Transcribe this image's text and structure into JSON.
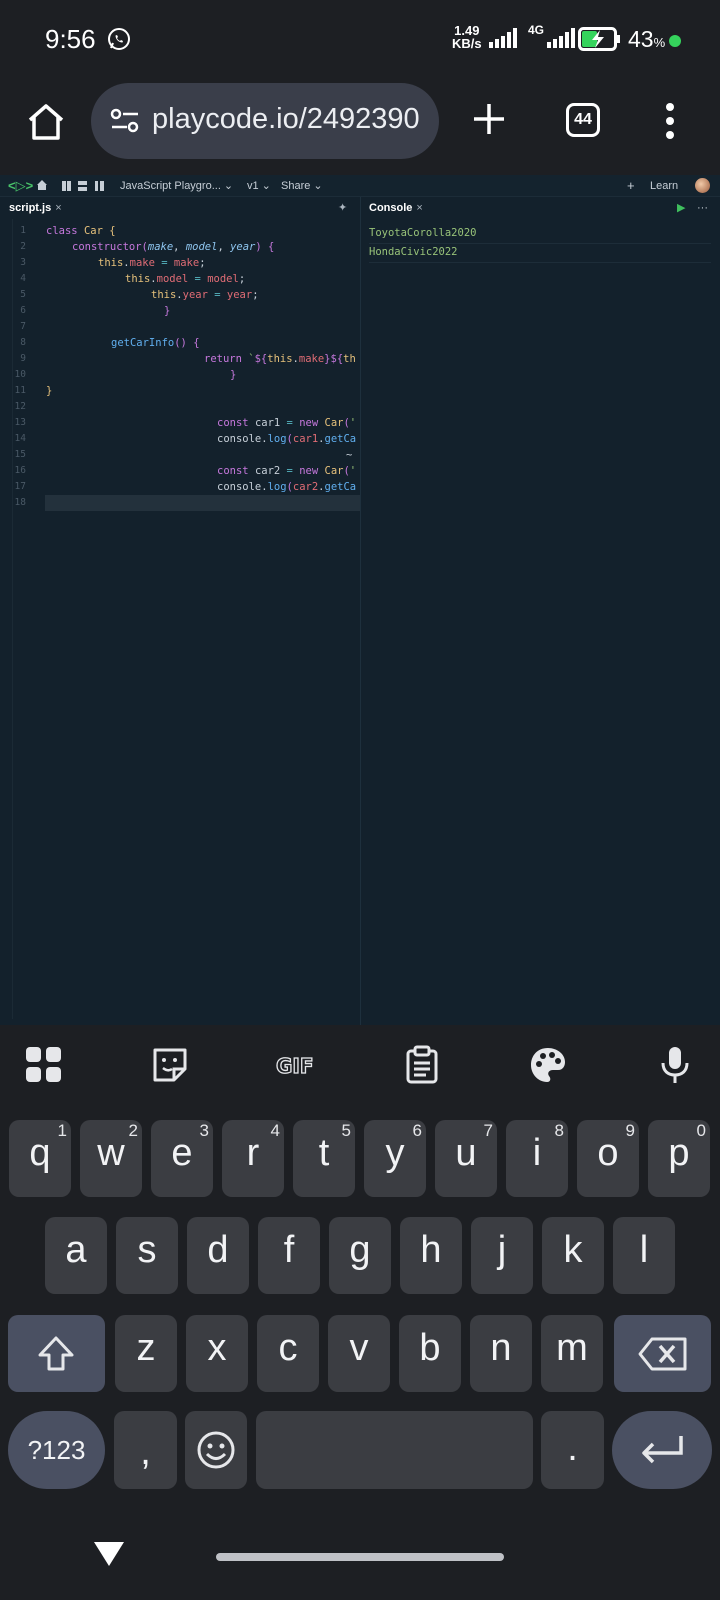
{
  "status_bar": {
    "time": "9:56",
    "net_speed_value": "1.49",
    "net_speed_unit": "KB/s",
    "network": "4G",
    "battery": "43",
    "battery_unit": "%"
  },
  "browser": {
    "url": "playcode.io/2492390",
    "tab_count": "44"
  },
  "editor": {
    "toolbar": {
      "logo": "<▷>",
      "project": "JavaScript Playgro... ⌄",
      "version": "v1 ⌄",
      "share": "Share ⌄",
      "new": "+",
      "learn": "Learn"
    },
    "file_tab": {
      "label": "script.js",
      "close": "×"
    },
    "console_tab": {
      "label": "Console",
      "close": "×"
    },
    "run": "▶",
    "more": "···",
    "line_numbers": [
      "1",
      "2",
      "3",
      "4",
      "5",
      "6",
      "7",
      "8",
      "9",
      "10",
      "11",
      "12",
      "13",
      "14",
      "15",
      "16",
      "17",
      "18"
    ],
    "console_output": [
      "ToyotaCorolla2020",
      "HondaCivic2022"
    ]
  },
  "keyboard": {
    "row1": [
      {
        "k": "q",
        "h": "1"
      },
      {
        "k": "w",
        "h": "2"
      },
      {
        "k": "e",
        "h": "3"
      },
      {
        "k": "r",
        "h": "4"
      },
      {
        "k": "t",
        "h": "5"
      },
      {
        "k": "y",
        "h": "6"
      },
      {
        "k": "u",
        "h": "7"
      },
      {
        "k": "i",
        "h": "8"
      },
      {
        "k": "o",
        "h": "9"
      },
      {
        "k": "p",
        "h": "0"
      }
    ],
    "row2": [
      "a",
      "s",
      "d",
      "f",
      "g",
      "h",
      "j",
      "k",
      "l"
    ],
    "row3": [
      "z",
      "x",
      "c",
      "v",
      "b",
      "n",
      "m"
    ],
    "symbols": "?123",
    "comma": ",",
    "period": "."
  },
  "colors": {
    "status_bg": "#1d1f23",
    "editor_bg": "#13212c",
    "accent_green": "#35d35c",
    "console_text": "#98c379"
  }
}
